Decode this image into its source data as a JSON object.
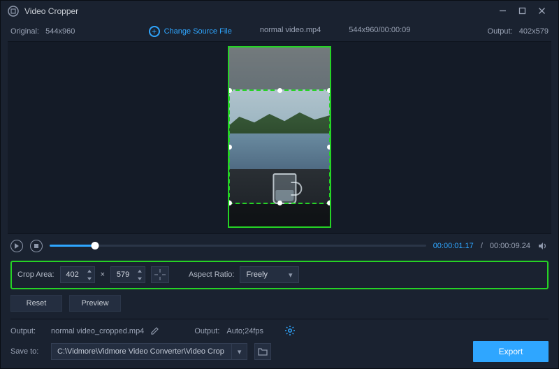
{
  "titlebar": {
    "title": "Video Cropper"
  },
  "infobar": {
    "original_label": "Original:",
    "original_value": "544x960",
    "change_source": "Change Source File",
    "filename": "normal video.mp4",
    "src_info": "544x960/00:00:09",
    "output_label": "Output:",
    "output_value": "402x579"
  },
  "playback": {
    "current": "00:00:01.17",
    "total": "00:00:09.24"
  },
  "crop": {
    "area_label": "Crop Area:",
    "width": "402",
    "height": "579",
    "multiply": "×",
    "aspect_label": "Aspect Ratio:",
    "aspect_value": "Freely"
  },
  "buttons": {
    "reset": "Reset",
    "preview": "Preview",
    "export": "Export"
  },
  "output": {
    "label": "Output:",
    "filename": "normal video_cropped.mp4",
    "settings_label": "Output:",
    "settings_value": "Auto;24fps"
  },
  "save": {
    "label": "Save to:",
    "path": "C:\\Vidmore\\Vidmore Video Converter\\Video Crop"
  }
}
